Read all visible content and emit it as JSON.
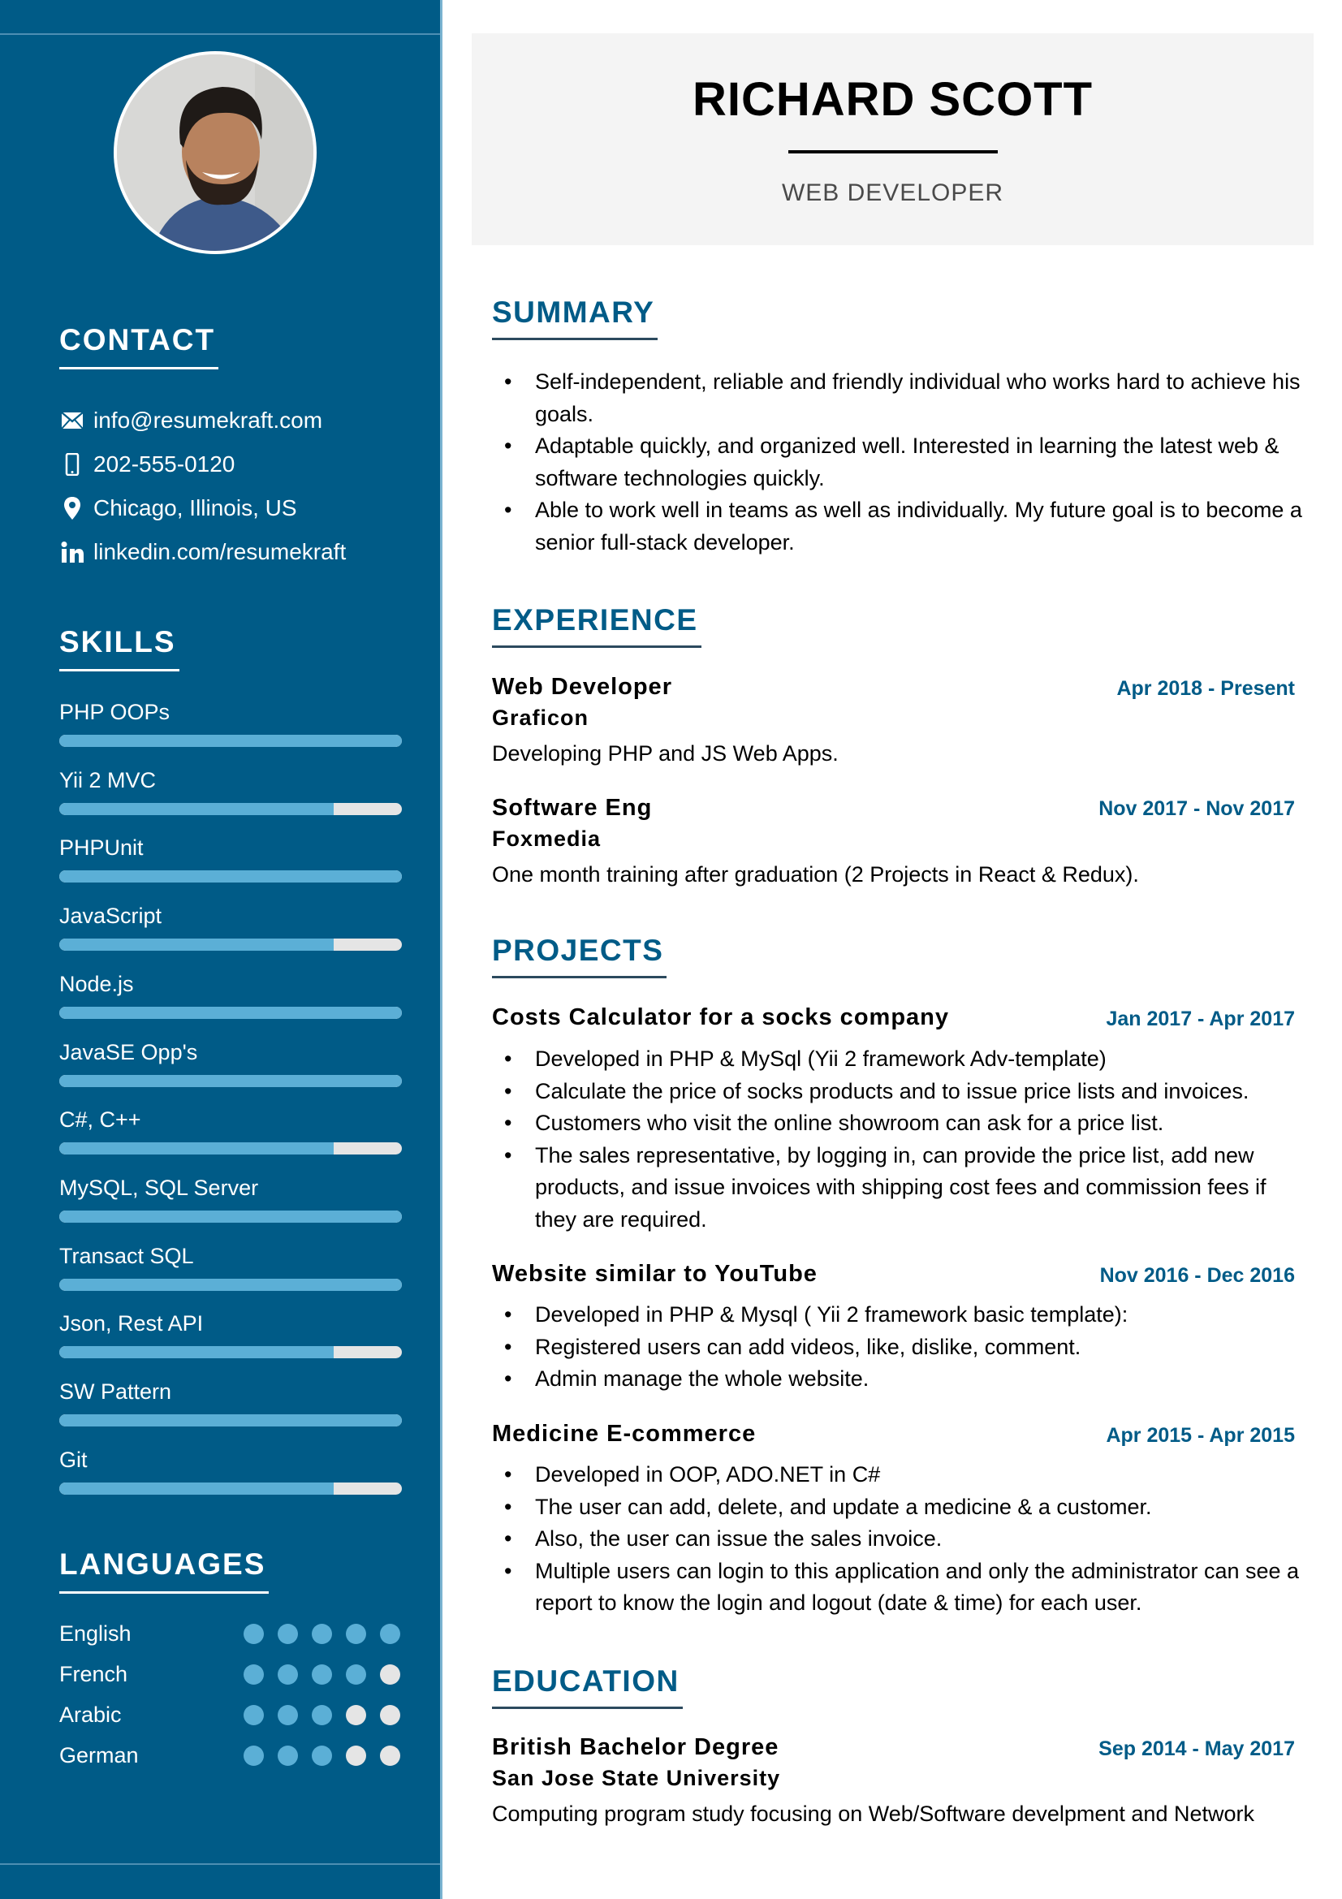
{
  "colors": {
    "sidebar": "#005b87",
    "accent": "#005b87",
    "bar_fill": "#5bafd6",
    "bar_empty": "#e5e5e5",
    "header_bg": "#f4f4f4"
  },
  "header": {
    "name": "RICHARD SCOTT",
    "role": "WEB DEVELOPER"
  },
  "sidebar": {
    "photo": "profile-photo",
    "contact": {
      "title": "CONTACT",
      "items": [
        {
          "icon": "email-icon",
          "text": "info@resumekraft.com"
        },
        {
          "icon": "phone-icon",
          "text": "202-555-0120"
        },
        {
          "icon": "location-icon",
          "text": "Chicago, Illinois, US"
        },
        {
          "icon": "linkedin-icon",
          "text": "linkedin.com/resumekraft"
        }
      ]
    },
    "skills": {
      "title": "SKILLS",
      "items": [
        {
          "label": "PHP OOPs",
          "level": 100
        },
        {
          "label": "Yii 2 MVC",
          "level": 80
        },
        {
          "label": "PHPUnit",
          "level": 100
        },
        {
          "label": "JavaScript",
          "level": 80
        },
        {
          "label": "Node.js",
          "level": 100
        },
        {
          "label": "JavaSE Opp's",
          "level": 100
        },
        {
          "label": "C#, C++",
          "level": 80
        },
        {
          "label": "MySQL, SQL Server",
          "level": 100
        },
        {
          "label": "Transact SQL",
          "level": 100
        },
        {
          "label": "Json, Rest API",
          "level": 80
        },
        {
          "label": "SW Pattern",
          "level": 100
        },
        {
          "label": "Git",
          "level": 80
        }
      ]
    },
    "languages": {
      "title": "LANGUAGES",
      "max": 5,
      "items": [
        {
          "name": "English",
          "rating": 5
        },
        {
          "name": "French",
          "rating": 4
        },
        {
          "name": "Arabic",
          "rating": 3
        },
        {
          "name": "German",
          "rating": 3
        }
      ]
    }
  },
  "summary": {
    "title": "SUMMARY",
    "bullets": [
      "Self-independent, reliable and friendly individual who works hard to achieve his goals.",
      "Adaptable quickly, and organized well. Interested in learning the latest web & software technologies quickly.",
      "Able to work well in teams as well as individually. My future goal is to become a senior full-stack developer."
    ]
  },
  "experience": {
    "title": "EXPERIENCE",
    "items": [
      {
        "role": "Web Developer",
        "company": "Graficon",
        "dates": "Apr 2018 - Present",
        "description": "Developing PHP and JS Web Apps."
      },
      {
        "role": "Software Eng",
        "company": "Foxmedia",
        "dates": "Nov 2017 - Nov 2017",
        "description": "One month training after graduation (2 Projects in React & Redux)."
      }
    ]
  },
  "projects": {
    "title": "PROJECTS",
    "items": [
      {
        "name": "Costs Calculator for a socks company",
        "dates": "Jan 2017 - Apr 2017",
        "bullets": [
          "Developed in PHP & MySql (Yii 2 framework Adv-template)",
          "Calculate the price of socks products and to issue price lists and invoices.",
          "Customers who visit the online showroom can ask for a price list.",
          "The sales representative, by logging in, can provide the price list, add new products, and issue invoices with shipping cost fees and commission fees if they are required."
        ]
      },
      {
        "name": "Website similar to YouTube",
        "dates": "Nov 2016 - Dec 2016",
        "bullets": [
          "Developed in PHP & Mysql ( Yii 2 framework basic template):",
          "Registered users can add videos, like, dislike, comment.",
          "Admin manage the whole website."
        ]
      },
      {
        "name": "Medicine E-commerce",
        "dates": "Apr 2015 - Apr 2015",
        "bullets": [
          "Developed in OOP, ADO.NET in C#",
          "The user can add, delete, and update a medicine & a customer.",
          "Also, the user can issue the sales invoice.",
          "Multiple users can login to this application and only the administrator can see a report to know the login and logout (date & time) for each user."
        ]
      }
    ]
  },
  "education": {
    "title": "EDUCATION",
    "items": [
      {
        "degree": "British Bachelor Degree",
        "school": "San Jose State University",
        "dates": "Sep 2014 - May 2017",
        "description": "Computing program study focusing on Web/Software develpment and Network"
      }
    ]
  }
}
